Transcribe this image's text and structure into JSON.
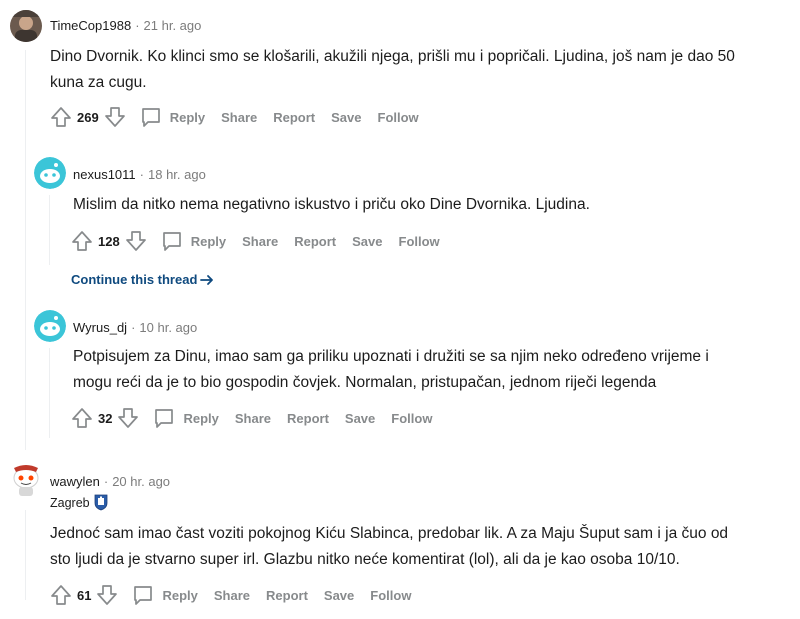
{
  "comments": [
    {
      "author": "TimeCop1988",
      "time": "21 hr. ago",
      "body_lines": [
        "Dino Dvornik. Ko klinci smo se klošarili, akužili njega, prišli mu i popričali. Ljudina, još nam je dao 50",
        "kuna za cugu."
      ],
      "score": "269"
    },
    {
      "author": "nexus1011",
      "time": "18 hr. ago",
      "body_lines": [
        "Mislim da nitko nema negativno iskustvo i priču oko Dine Dvornika. Ljudina."
      ],
      "score": "128"
    },
    {
      "author": "Wyrus_dj",
      "time": "10 hr. ago",
      "body_lines": [
        "Potpisujem za Dinu, imao sam ga priliku upoznati i družiti se sa njim neko određeno vrijeme i",
        "mogu reći da je to bio gospodin čovjek. Normalan, pristupačan, jednom riječi legenda"
      ],
      "score": "32"
    },
    {
      "author": "wawylen",
      "time": "20 hr. ago",
      "flair": "Zagreb",
      "body_lines": [
        "Jednoć sam imao čast voziti pokojnog Kiću Slabinca, predobar lik. A za Maju Šuput sam i ja čuo od",
        "sto ljudi da je stvarno super irl. Glazbu nitko neće komentirat (lol), ali da je kao osoba 10/10."
      ],
      "score": "61"
    }
  ],
  "actions": {
    "reply": "Reply",
    "share": "Share",
    "report": "Report",
    "save": "Save",
    "follow": "Follow"
  },
  "separator": "·",
  "continue_thread": "Continue this thread",
  "colors": {
    "avatar_teal": "#3bc5d8",
    "link": "#0f4a7f",
    "muted": "#7c7c7c"
  }
}
